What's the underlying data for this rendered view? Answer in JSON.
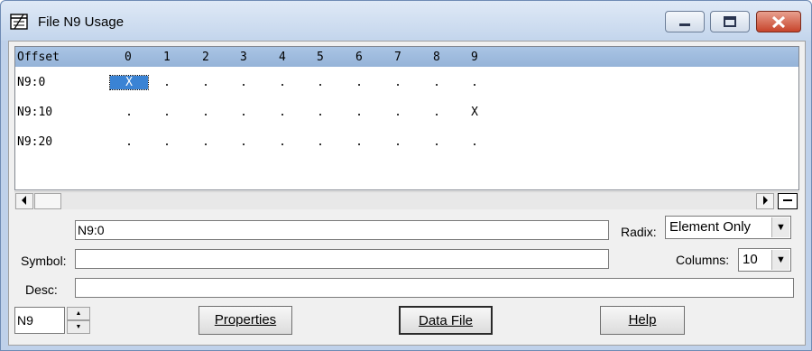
{
  "window": {
    "title": "File N9 Usage"
  },
  "grid": {
    "offset_header": "Offset",
    "columns": [
      "0",
      "1",
      "2",
      "3",
      "4",
      "5",
      "6",
      "7",
      "8",
      "9"
    ],
    "rows": [
      {
        "label": "N9:0",
        "cells": [
          "X",
          ".",
          ".",
          ".",
          ".",
          ".",
          ".",
          ".",
          ".",
          "."
        ]
      },
      {
        "label": "N9:10",
        "cells": [
          ".",
          ".",
          ".",
          ".",
          ".",
          ".",
          ".",
          ".",
          ".",
          "X"
        ]
      },
      {
        "label": "N9:20",
        "cells": [
          ".",
          ".",
          ".",
          ".",
          ".",
          ".",
          ".",
          ".",
          ".",
          "."
        ]
      }
    ],
    "selected_cell": "N9:0 / column 0"
  },
  "address_field": {
    "value": "N9:0"
  },
  "radix": {
    "label": "Radix:",
    "value": "Element Only"
  },
  "symbol": {
    "label": "Symbol:",
    "value": ""
  },
  "columns_select": {
    "label": "Columns:",
    "value": "10"
  },
  "desc": {
    "label": "Desc:",
    "value": ""
  },
  "file_spinner": {
    "value": "N9"
  },
  "buttons": {
    "properties": "Properties",
    "data_file": "Data File",
    "help": "Help"
  },
  "icons": {
    "app": "data-table-icon",
    "minimize": "minimize-icon",
    "maximize": "maximize-icon",
    "close": "close-icon",
    "scroll_left": "scroll-left-arrow-icon",
    "scroll_right": "scroll-right-arrow-icon",
    "split": "minus-icon"
  }
}
